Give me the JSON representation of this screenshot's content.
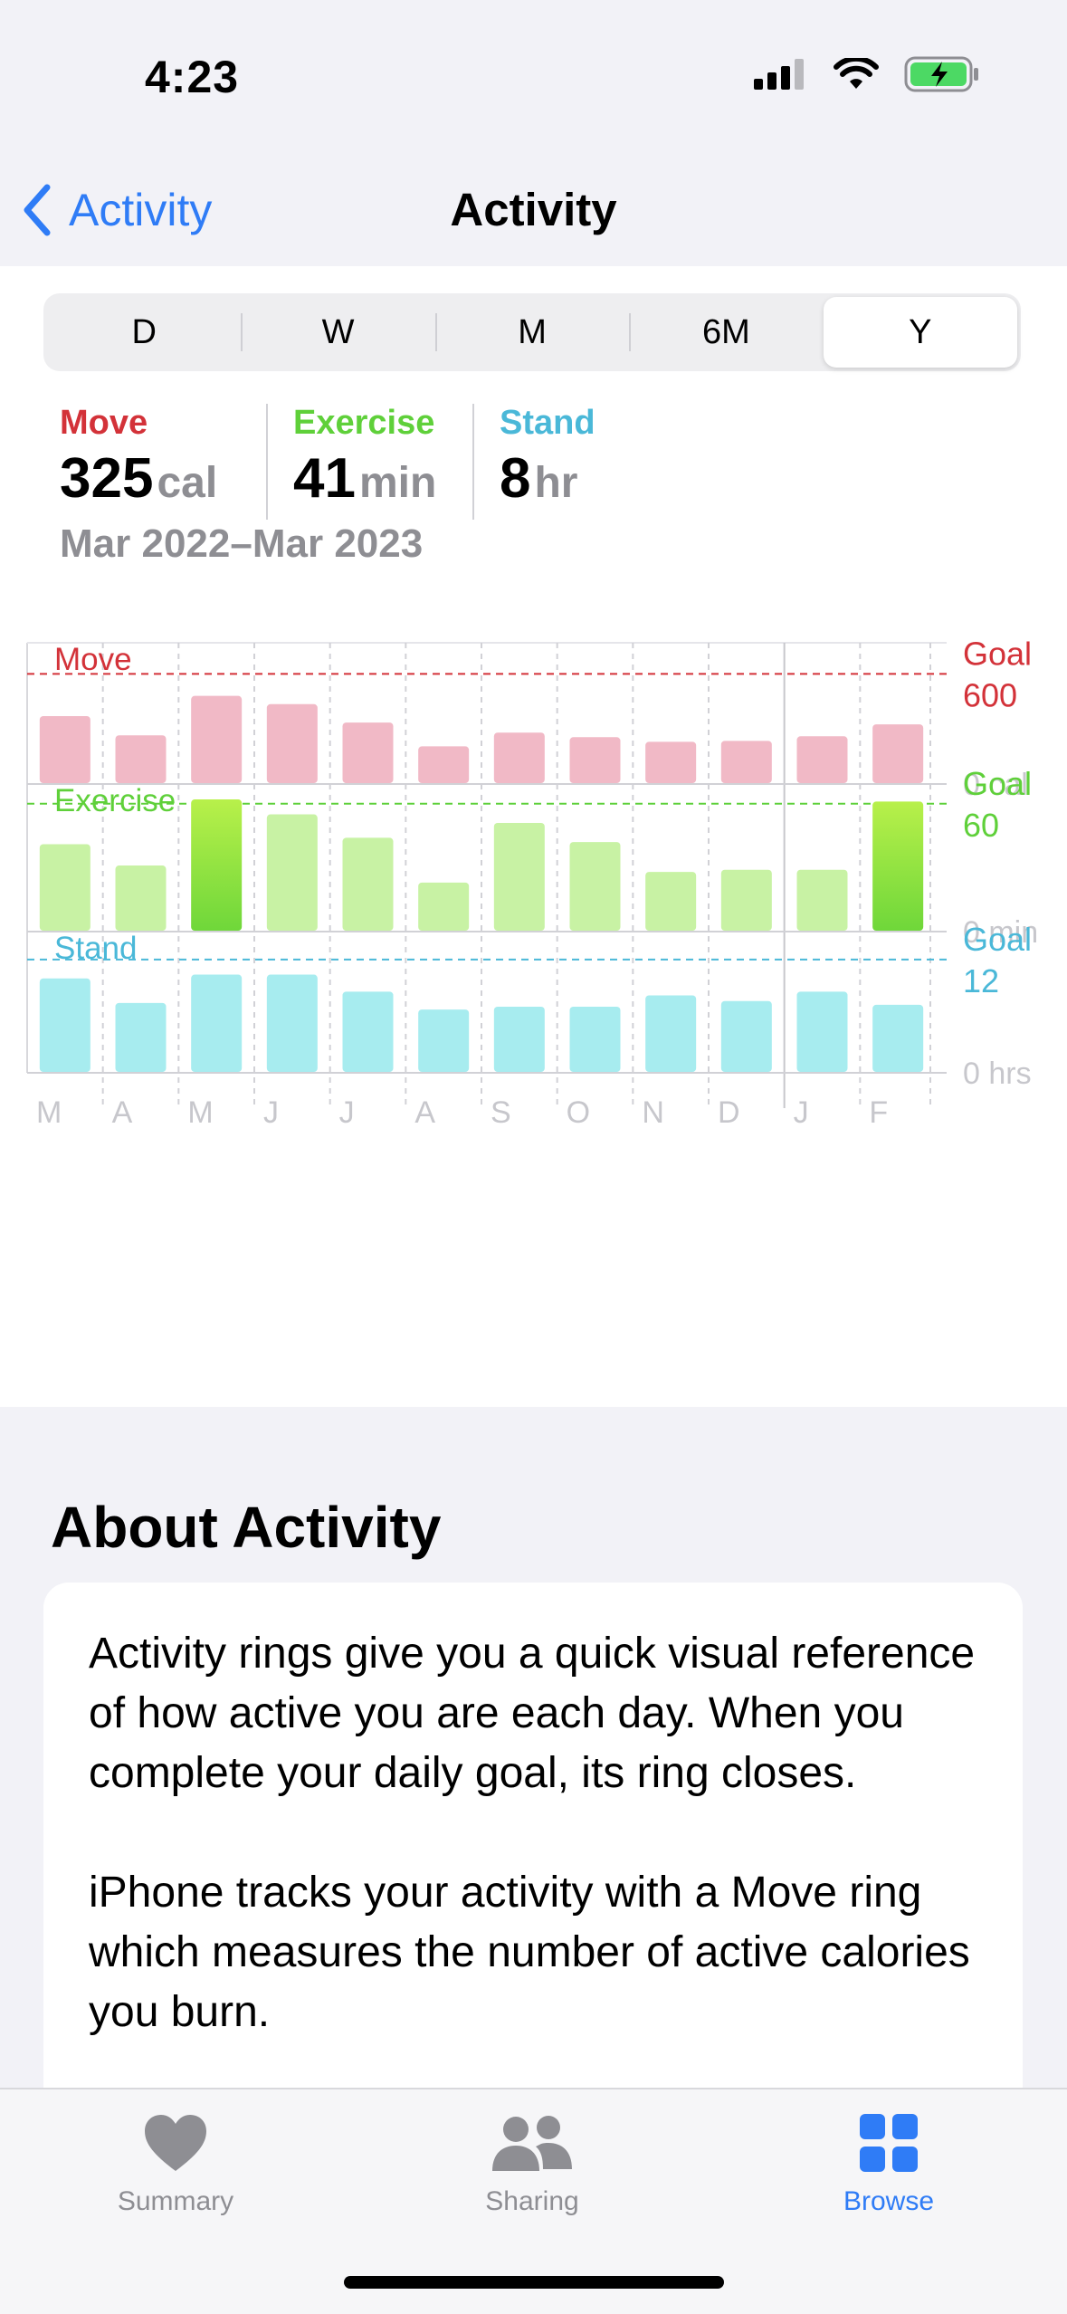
{
  "status": {
    "time": "4:23"
  },
  "nav": {
    "back_label": "Activity",
    "title": "Activity"
  },
  "segments": [
    {
      "label": "D",
      "active": false
    },
    {
      "label": "W",
      "active": false
    },
    {
      "label": "M",
      "active": false
    },
    {
      "label": "6M",
      "active": false
    },
    {
      "label": "Y",
      "active": true
    }
  ],
  "summary": {
    "move": {
      "label": "Move",
      "value": "325",
      "unit": "cal"
    },
    "exercise": {
      "label": "Exercise",
      "value": "41",
      "unit": "min"
    },
    "stand": {
      "label": "Stand",
      "value": "8",
      "unit": "hr"
    },
    "date_start": "Mar 2022",
    "date_sep": "–",
    "date_end": "Mar 2023"
  },
  "colors": {
    "move": "#d33239",
    "move_bar": "#f1b9c6",
    "exercise": "#5fd03a",
    "exercise_bar": "#c8f2a4",
    "exercise_bar_hi": "#6fd73a",
    "stand": "#4ab8d8",
    "stand_bar": "#a7ecef",
    "accent": "#2f7cf6"
  },
  "chart_data": {
    "type": "bar",
    "categories": [
      "M",
      "A",
      "M",
      "J",
      "J",
      "A",
      "S",
      "O",
      "N",
      "D",
      "J",
      "F"
    ],
    "series": [
      {
        "name": "Move",
        "values": [
          370,
          265,
          480,
          435,
          335,
          205,
          280,
          255,
          230,
          235,
          260,
          325
        ],
        "goal": 600,
        "goal_label": "Goal",
        "goal_value": "600",
        "zero_label": "0 cal",
        "max": 720
      },
      {
        "name": "Exercise",
        "values": [
          41,
          31,
          62,
          55,
          44,
          23,
          51,
          42,
          28,
          29,
          29,
          61
        ],
        "goal": 60,
        "goal_label": "Goal",
        "goal_value": "60",
        "zero_label": "0 min",
        "goal_met": [
          false,
          false,
          true,
          false,
          false,
          false,
          false,
          false,
          false,
          false,
          false,
          true
        ],
        "max": 65
      },
      {
        "name": "Stand",
        "values": [
          10.0,
          7.4,
          10.4,
          10.4,
          8.6,
          6.7,
          7.0,
          7.0,
          8.2,
          7.6,
          8.6,
          7.2
        ],
        "goal": 12,
        "goal_label": "Goal",
        "goal_value": "12",
        "zero_label": "0 hrs",
        "max": 14
      }
    ]
  },
  "about": {
    "title": "About Activity",
    "p1": "Activity rings give you a quick visual reference of how active you are each day. When you complete your daily goal, its ring closes.",
    "p2": "iPhone tracks your activity with a Move ring which measures the number of active calories you burn."
  },
  "tabs": [
    {
      "label": "Summary",
      "icon": "heart-icon",
      "active": false
    },
    {
      "label": "Sharing",
      "icon": "people-icon",
      "active": false
    },
    {
      "label": "Browse",
      "icon": "grid-icon",
      "active": true
    }
  ]
}
